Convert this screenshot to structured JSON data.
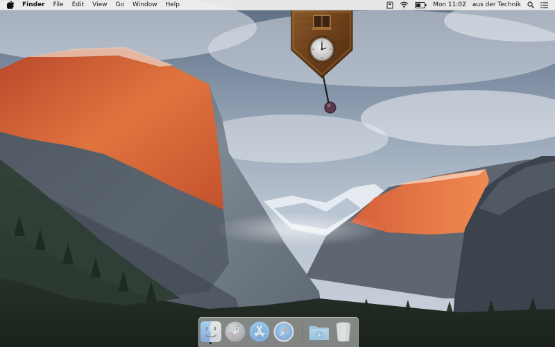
{
  "menubar": {
    "apple_icon": "apple-logo-icon",
    "app_name": "Finder",
    "menus": [
      "File",
      "Edit",
      "View",
      "Go",
      "Window",
      "Help"
    ],
    "status_icons": [
      "time-machine-icon",
      "wifi-icon",
      "battery-icon"
    ],
    "clock": "Mon 11:02",
    "user": "aus der Technik",
    "spotlight_icon": "spotlight-search-icon",
    "notification_icon": "notification-center-icon"
  },
  "widget": {
    "type": "cuckoo-clock",
    "icon": "cuckoo-clock-icon"
  },
  "dock": {
    "apps": [
      {
        "name": "Finder",
        "icon": "finder-icon",
        "running": true
      },
      {
        "name": "Launchpad",
        "icon": "launchpad-icon",
        "running": false
      },
      {
        "name": "App Store",
        "icon": "app-store-icon",
        "running": false
      },
      {
        "name": "Safari",
        "icon": "safari-icon",
        "running": false
      }
    ],
    "stack": [
      {
        "name": "Downloads",
        "icon": "downloads-folder-icon"
      },
      {
        "name": "Trash",
        "icon": "trash-icon"
      }
    ]
  }
}
